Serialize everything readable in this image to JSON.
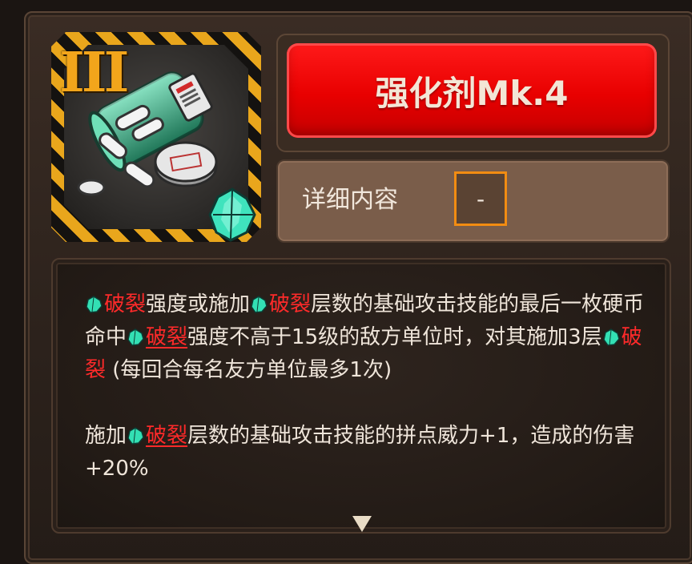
{
  "item": {
    "rank_numeral": "III",
    "icon": "pill-bottle-icon",
    "badge_icon": "crystal-badge-icon",
    "title": "强化剂Mk.4",
    "accent_color": "#e80000",
    "frame_stripe_color": "#e9a61c",
    "keyword_color": "#ff2a2a",
    "gem_color": "#33e0b4"
  },
  "details": {
    "label": "详细内容",
    "toggle_value": "-"
  },
  "description": {
    "keyword": "破裂",
    "p1": {
      "s1": "强度或施加",
      "s2": "层数的基础攻击技能的最后一枚硬币命中",
      "s3": "强度不高于15级的敌方单位时，对其施加3层",
      "s4": " (每回合每名友方单位最多1次)"
    },
    "p2": {
      "s1": "施加",
      "s2": "层数的基础攻击技能的拼点威力+1，造成的伤害+20%"
    }
  },
  "scroll_indicator": "down-arrow-icon"
}
